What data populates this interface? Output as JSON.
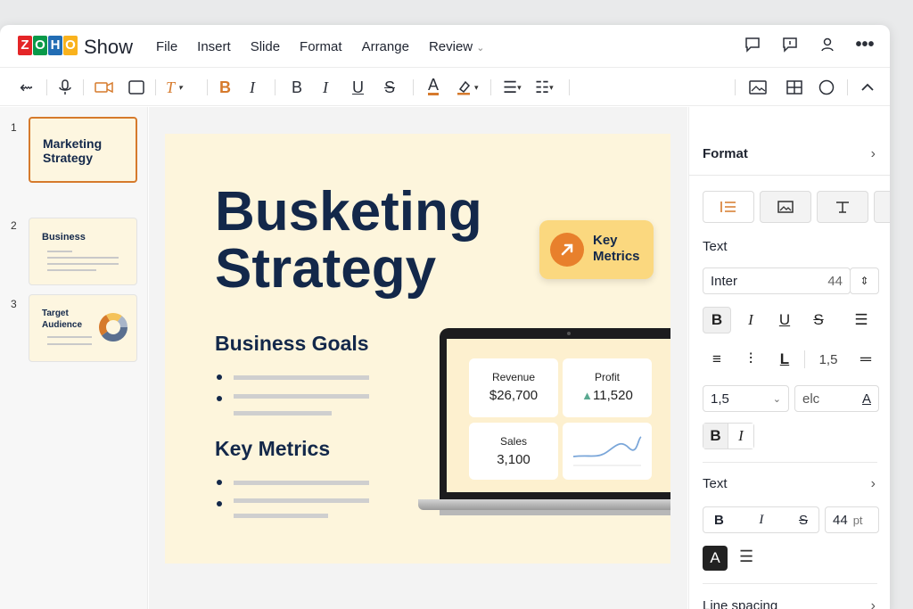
{
  "app": {
    "logo_letters": [
      "Z",
      "O",
      "H",
      "O"
    ],
    "logo_colors": [
      "#e42527",
      "#089949",
      "#226db4",
      "#f9b21d"
    ],
    "name": "Show"
  },
  "menu": [
    "File",
    "Insert",
    "Slide",
    "Format",
    "Arrange",
    "Review"
  ],
  "slides": [
    {
      "num": "1",
      "title_line1": "Marketing",
      "title_line2": "Strategy"
    },
    {
      "num": "2",
      "title": "Business"
    },
    {
      "num": "3",
      "title_line1": "Target",
      "title_line2": "Audience"
    }
  ],
  "slide": {
    "title_line1": "Busketing",
    "title_line2": "Strategy",
    "section1": "Business Goals",
    "section2": "Key Metrics",
    "badge_line1": "Key",
    "badge_line2": "Metrics",
    "cards": [
      {
        "label": "Revenue",
        "value": "$26,700"
      },
      {
        "label": "Profit",
        "value": "11,520"
      },
      {
        "label": "Sales",
        "value": "3,100"
      }
    ]
  },
  "panel": {
    "format_title": "Format",
    "text_title": "Text",
    "font_name": "Inter",
    "font_size": "44",
    "spacing_value": "1,5",
    "spacing_select": "1,5",
    "font_field2": "elc",
    "text_title2": "Text",
    "size2": "44",
    "size2_unit": "pt",
    "line_spacing": "Line spacing"
  },
  "colors": {
    "accent": "#d67a2c",
    "navy": "#13284a",
    "slide_bg": "#fdf5dc",
    "badge": "#fbd87f"
  }
}
